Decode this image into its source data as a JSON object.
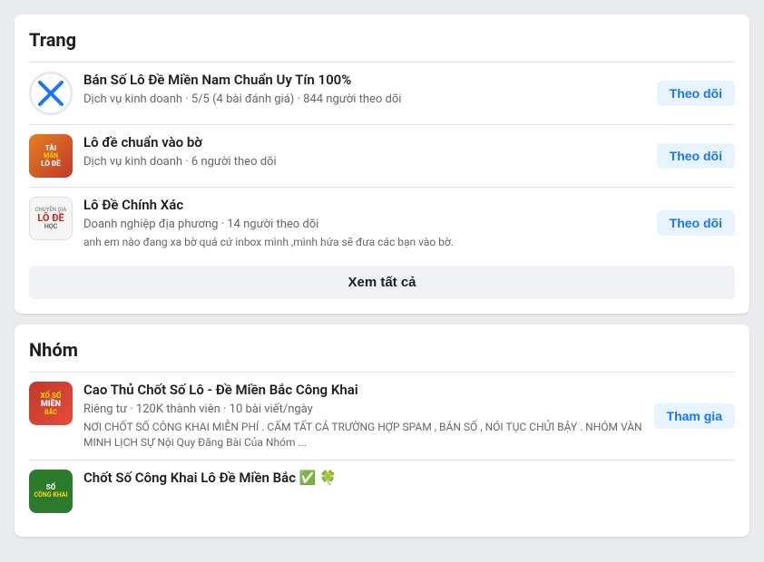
{
  "pages_section": {
    "title": "Trang",
    "items": [
      {
        "id": "page1",
        "name": "Bán Số Lô Đề Miền Nam Chuẩn Uy Tín 100%",
        "meta": "Dịch vụ kinh doanh · 5/5 (4 bài đánh giá) · 844 người theo dõi",
        "desc": "",
        "follow_label": "Theo dõi"
      },
      {
        "id": "page2",
        "name": "Lô đề chuẩn vào bờ",
        "meta": "Dịch vụ kinh doanh · 6 người theo dõi",
        "desc": "",
        "follow_label": "Theo dõi"
      },
      {
        "id": "page3",
        "name": "Lô Đề Chính Xác",
        "meta": "Doanh nghiệp địa phương · 14 người theo dõi",
        "desc": "anh em nào đang xa bờ quá cứ inbox mình ,mình hứa sẽ đưa các bạn vào bờ.",
        "follow_label": "Theo dõi"
      }
    ],
    "see_all_label": "Xem tất cả"
  },
  "groups_section": {
    "title": "Nhóm",
    "items": [
      {
        "id": "group1",
        "name": "Cao Thủ Chốt Số Lô - Đề Miền Bắc Công Khai",
        "meta": "Riêng tư · 120K thành viên · 10 bài viết/ngày",
        "desc": "NƠI CHỐT SỐ CÔNG KHAI MIỄN PHÍ . CẤM TẤT CẢ TRƯỜNG HỢP SPAM , BÁN SỐ , NÓI TỤC CHỬI BẬY . NHÓM VÀN MINH LỊCH SỰ Nội Quy Đăng Bài Của Nhóm ...",
        "join_label": "Tham gia"
      },
      {
        "id": "group2",
        "name": "Chốt Số Công Khai Lô Đề Miền Bắc ✅ 🍀",
        "meta": "",
        "desc": "",
        "join_label": ""
      }
    ]
  }
}
